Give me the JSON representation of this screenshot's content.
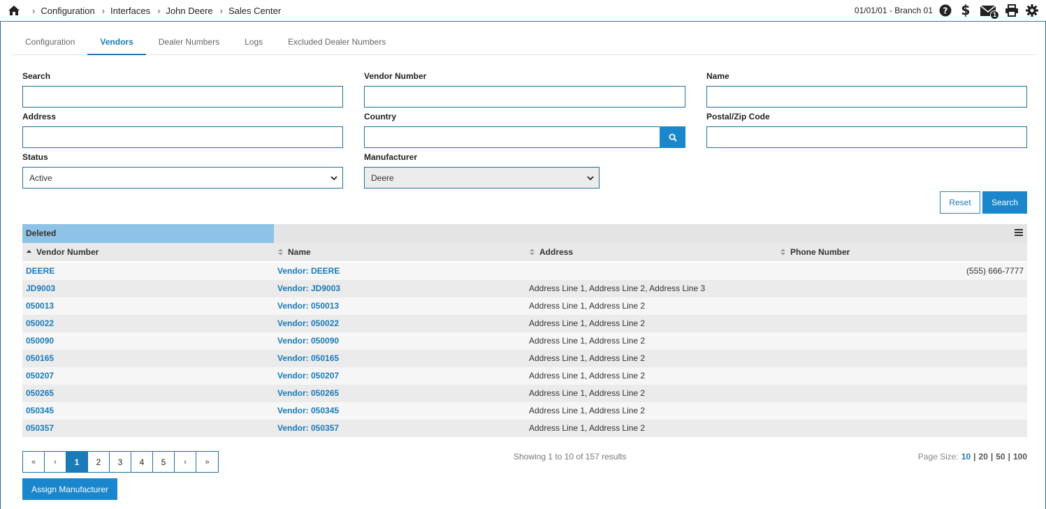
{
  "breadcrumb": [
    "Configuration",
    "Interfaces",
    "John Deere",
    "Sales Center"
  ],
  "header": {
    "branch": "01/01/01 - Branch 01",
    "mail_count": "1"
  },
  "tabs": [
    {
      "label": "Configuration",
      "active": false
    },
    {
      "label": "Vendors",
      "active": true
    },
    {
      "label": "Dealer Numbers",
      "active": false
    },
    {
      "label": "Logs",
      "active": false
    },
    {
      "label": "Excluded Dealer Numbers",
      "active": false
    }
  ],
  "form": {
    "search_label": "Search",
    "search_value": "",
    "vendor_number_label": "Vendor Number",
    "vendor_number_value": "",
    "name_label": "Name",
    "name_value": "",
    "address_label": "Address",
    "address_value": "",
    "country_label": "Country",
    "country_value": "",
    "postal_label": "Postal/Zip Code",
    "postal_value": "",
    "status_label": "Status",
    "status_value": "Active",
    "manufacturer_label": "Manufacturer",
    "manufacturer_value": "Deere",
    "reset_label": "Reset",
    "search_button_label": "Search"
  },
  "grid": {
    "group_tag": "Deleted",
    "columns": [
      "Vendor Number",
      "Name",
      "Address",
      "Phone Number"
    ],
    "rows": [
      {
        "vendor": "DEERE",
        "name": "Vendor: DEERE",
        "address": "",
        "phone": "(555) 666-7777"
      },
      {
        "vendor": "JD9003",
        "name": "Vendor: JD9003",
        "address": "Address Line 1, Address Line 2, Address Line 3",
        "phone": ""
      },
      {
        "vendor": "050013",
        "name": "Vendor: 050013",
        "address": "Address Line 1, Address Line 2",
        "phone": ""
      },
      {
        "vendor": "050022",
        "name": "Vendor: 050022",
        "address": "Address Line 1, Address Line 2",
        "phone": ""
      },
      {
        "vendor": "050090",
        "name": "Vendor: 050090",
        "address": "Address Line 1, Address Line 2",
        "phone": ""
      },
      {
        "vendor": "050165",
        "name": "Vendor: 050165",
        "address": "Address Line 1, Address Line 2",
        "phone": ""
      },
      {
        "vendor": "050207",
        "name": "Vendor: 050207",
        "address": "Address Line 1, Address Line 2",
        "phone": ""
      },
      {
        "vendor": "050265",
        "name": "Vendor: 050265",
        "address": "Address Line 1, Address Line 2",
        "phone": ""
      },
      {
        "vendor": "050345",
        "name": "Vendor: 050345",
        "address": "Address Line 1, Address Line 2",
        "phone": ""
      },
      {
        "vendor": "050357",
        "name": "Vendor: 050357",
        "address": "Address Line 1, Address Line 2",
        "phone": ""
      }
    ]
  },
  "pager": {
    "buttons": [
      "«",
      "‹",
      "1",
      "2",
      "3",
      "4",
      "5",
      "›",
      "»"
    ],
    "current": "1",
    "showing": "Showing 1 to 10 of 157 results",
    "page_size_label": "Page Size:",
    "page_sizes": [
      "10",
      "20",
      "50",
      "100"
    ],
    "page_size_current": "10"
  },
  "assign_button_label": "Assign Manufacturer",
  "colors": {
    "accent": "#1a86cc",
    "link": "#1a7bb9",
    "group_tag": "#8ec2e6"
  }
}
